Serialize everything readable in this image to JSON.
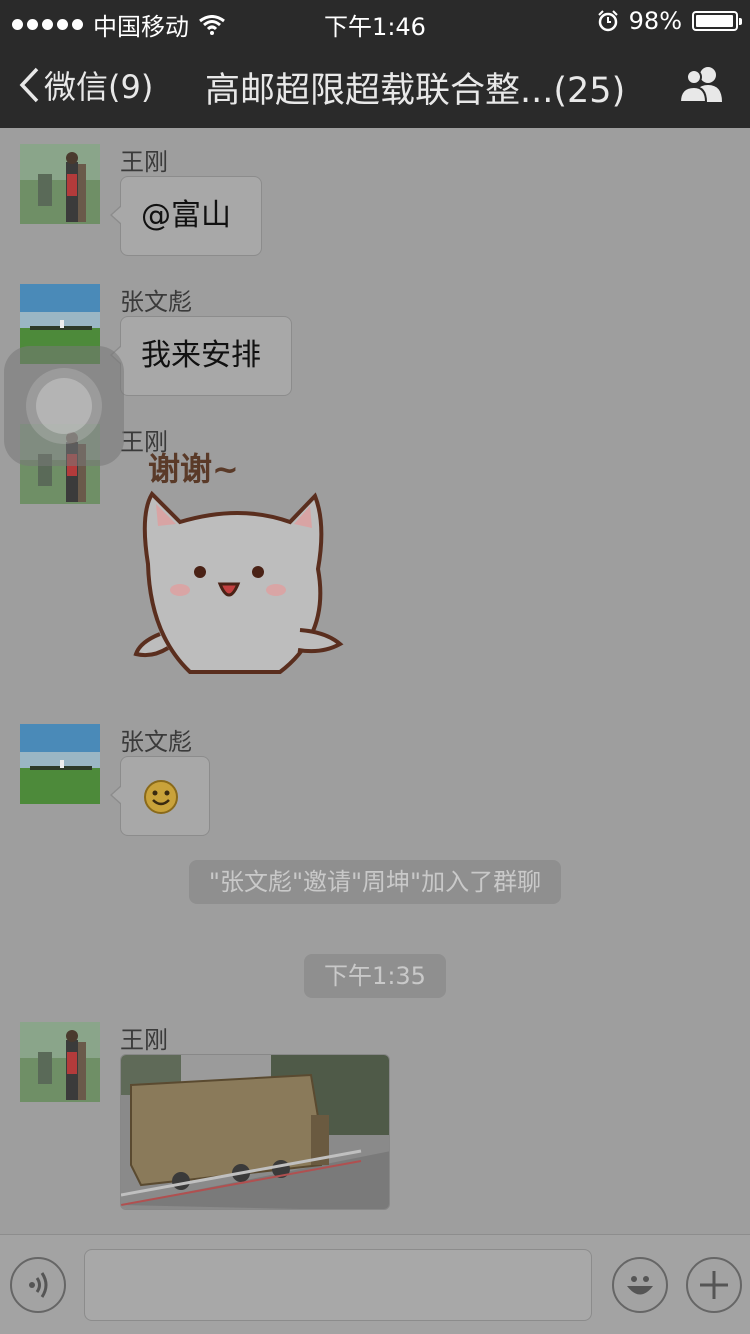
{
  "status_bar": {
    "carrier": "中国移动",
    "time": "下午1:46",
    "battery_text": "98%",
    "battery_level": 0.98
  },
  "nav": {
    "back_label": "微信(9)",
    "title": "高邮超限超载联合整...(25)"
  },
  "messages": [
    {
      "sender": "王刚",
      "text": "@富山"
    },
    {
      "sender": "张文彪",
      "text": "我来安排"
    },
    {
      "sender": "王刚",
      "sticker_text": "谢谢~"
    },
    {
      "sender": "张文彪"
    },
    {
      "sender": "王刚"
    }
  ],
  "system_tip": "\"张文彪\"邀请\"周坤\"加入了群聊",
  "timestamp_tip": "下午1:35",
  "input": {
    "value": "",
    "placeholder": ""
  },
  "colors": {
    "bar": "#2a2a2a",
    "background": "#9e9e9e"
  }
}
